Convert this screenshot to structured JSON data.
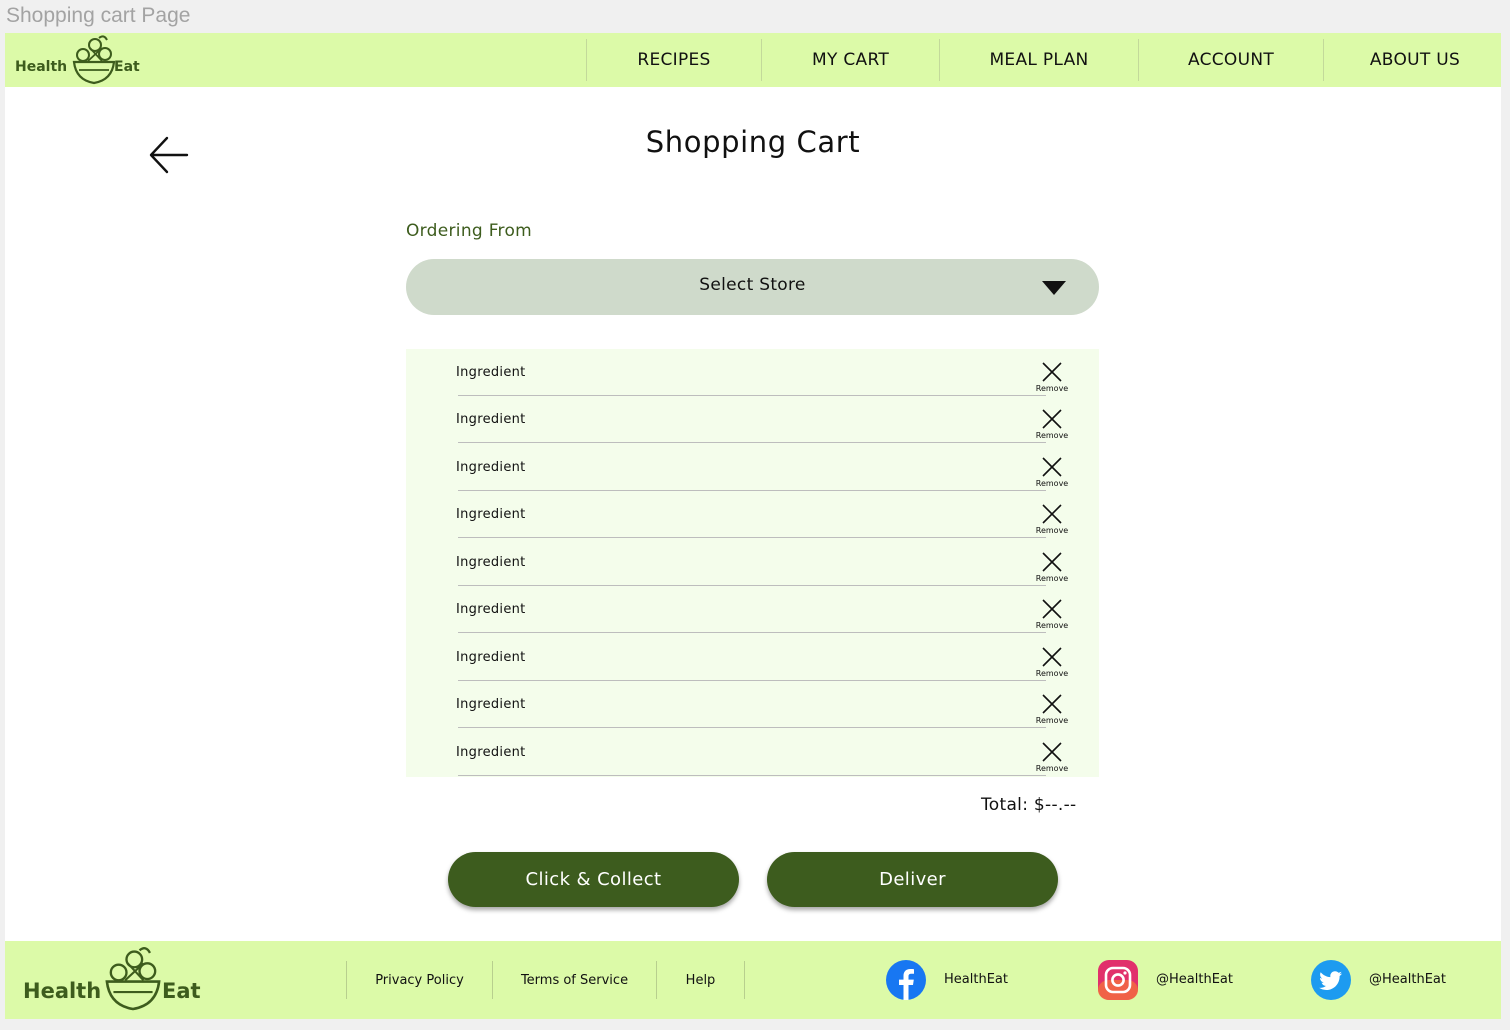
{
  "frame_title": "Shopping cart Page",
  "brand": {
    "word1": "Health",
    "word2": "Eat"
  },
  "nav": [
    {
      "label": "RECIPES"
    },
    {
      "label": "MY CART"
    },
    {
      "label": "MEAL PLAN"
    },
    {
      "label": "ACCOUNT"
    },
    {
      "label": "ABOUT US"
    }
  ],
  "page": {
    "title": "Shopping Cart"
  },
  "ordering": {
    "label": "Ordering From",
    "store_select": "Select Store"
  },
  "cart": {
    "items": [
      {
        "name": "Ingredient",
        "remove_label": "Remove"
      },
      {
        "name": "Ingredient",
        "remove_label": "Remove"
      },
      {
        "name": "Ingredient",
        "remove_label": "Remove"
      },
      {
        "name": "Ingredient",
        "remove_label": "Remove"
      },
      {
        "name": "Ingredient",
        "remove_label": "Remove"
      },
      {
        "name": "Ingredient",
        "remove_label": "Remove"
      },
      {
        "name": "Ingredient",
        "remove_label": "Remove"
      },
      {
        "name": "Ingredient",
        "remove_label": "Remove"
      },
      {
        "name": "Ingredient",
        "remove_label": "Remove"
      }
    ],
    "total": "Total: $--.--"
  },
  "actions": {
    "click_collect": "Click & Collect",
    "deliver": "Deliver"
  },
  "footer": {
    "links": [
      {
        "label": "Privacy Policy"
      },
      {
        "label": "Terms of Service"
      },
      {
        "label": "Help"
      }
    ],
    "social": [
      {
        "icon": "facebook-icon",
        "handle": "HealthEat"
      },
      {
        "icon": "instagram-icon",
        "handle": "@HealthEat"
      },
      {
        "icon": "twitter-icon",
        "handle": "@HealthEat"
      }
    ]
  },
  "colors": {
    "header_bg": "#dcfaa8",
    "brand_green": "#3d5c1e",
    "select_bg": "#cfdacb",
    "list_bg": "#f4fdeb"
  }
}
